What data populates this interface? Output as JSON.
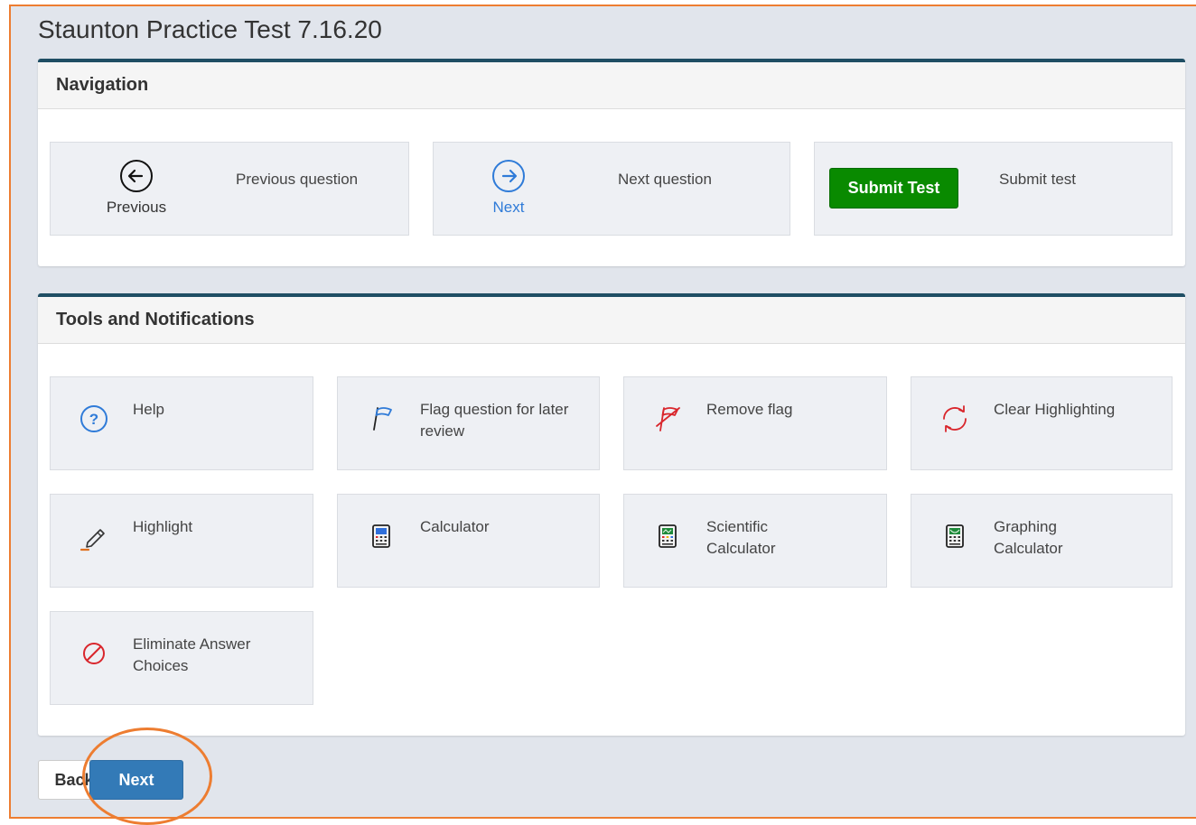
{
  "page": {
    "title": "Staunton Practice Test 7.16.20"
  },
  "navigation": {
    "heading": "Navigation",
    "previous": {
      "icon_label": "Previous",
      "description": "Previous question",
      "icon": "arrow-left-circle-icon"
    },
    "next": {
      "icon_label": "Next",
      "description": "Next question",
      "icon": "arrow-right-circle-icon"
    },
    "submit": {
      "button_label": "Submit Test",
      "description": "Submit test"
    }
  },
  "tools": {
    "heading": "Tools and Notifications",
    "items": [
      {
        "label": "Help",
        "icon": "help-icon"
      },
      {
        "label": "Flag question for later review",
        "icon": "flag-icon"
      },
      {
        "label": "Remove flag",
        "icon": "remove-flag-icon"
      },
      {
        "label": "Clear Highlighting",
        "icon": "refresh-icon"
      },
      {
        "label": "Highlight",
        "icon": "highlighter-icon"
      },
      {
        "label": "Calculator",
        "icon": "calculator-icon"
      },
      {
        "label": "Scientific Calculator",
        "icon": "scientific-calculator-icon"
      },
      {
        "label": "Graphing Calculator",
        "icon": "graphing-calculator-icon"
      },
      {
        "label": "Eliminate Answer Choices",
        "icon": "eliminate-icon"
      }
    ]
  },
  "footer": {
    "back_label": "Back",
    "next_label": "Next"
  },
  "colors": {
    "accent_orange": "#ED7D31",
    "panel_border": "#1F4E64",
    "submit_green": "#098A00",
    "primary_blue": "#337AB7",
    "icon_blue": "#2F7BD8",
    "icon_red": "#D9262C"
  }
}
